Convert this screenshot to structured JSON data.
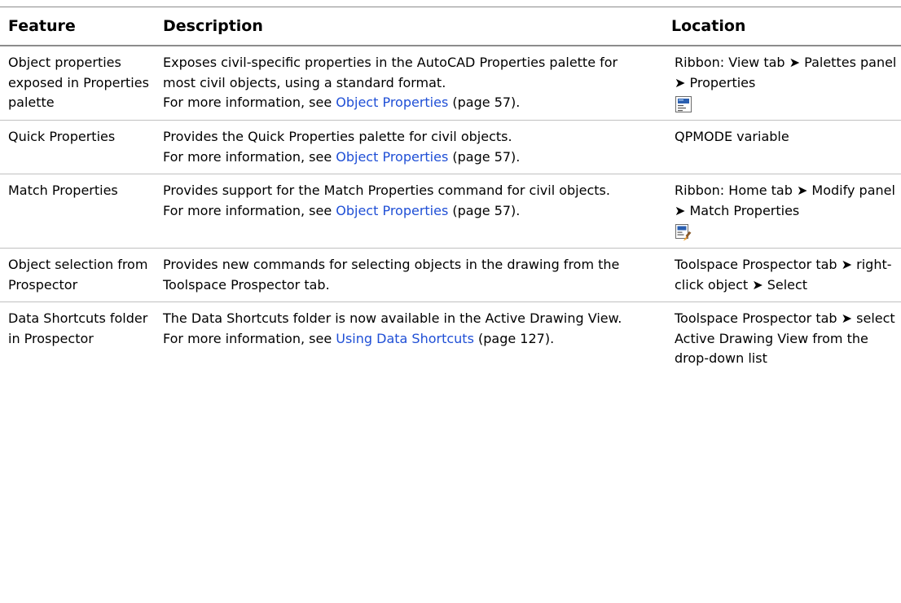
{
  "header": {
    "feature": "Feature",
    "description": "Description",
    "location": "Location"
  },
  "rows": [
    {
      "feature": "Object properties exposed in Prop­erties palette",
      "desc_text": "Exposes civil-specific properties in the AutoCAD Properties palette for most civil objects, using a standard format.",
      "more_prefix": "For more information, see ",
      "link": "Object Properties",
      "link_suffix": " (page 57).",
      "location": "Ribbon: View tab ➤ Palettes panel ➤ Properties",
      "icon": "properties-palette-icon"
    },
    {
      "feature": "Quick Properties",
      "desc_text": "Provides the Quick Properties palette for civil objects.",
      "more_prefix": "For more information, see ",
      "link": "Object Properties",
      "link_suffix": " (page 57).",
      "location": "QPMODE variable"
    },
    {
      "feature": "Match Properties",
      "desc_text": "Provides support for the Match Properties command for civil objects.",
      "more_prefix": "For more information, see ",
      "link": "Object Properties",
      "link_suffix": " (page 57).",
      "location": "Ribbon: Home tab ➤ Modify panel ➤ Match Properties",
      "icon": "match-properties-icon"
    },
    {
      "feature": "Object selection from Prospector",
      "desc_text": "Provides new commands for selecting objects in the drawing from the Toolspace Prospector tab.",
      "location": "Toolspace Prospector tab ➤ right-click object ➤ Select"
    },
    {
      "feature": "Data Shortcuts folder in Prospect­or",
      "desc_text": "The Data Shortcuts folder is now available in the Active Drawing View. For more information, see ",
      "link": "Using Data Shortcuts",
      "link_suffix": " (page 127).",
      "location": "Toolspace Prospector tab ➤ select Active Drawing View from the drop-down list"
    }
  ]
}
